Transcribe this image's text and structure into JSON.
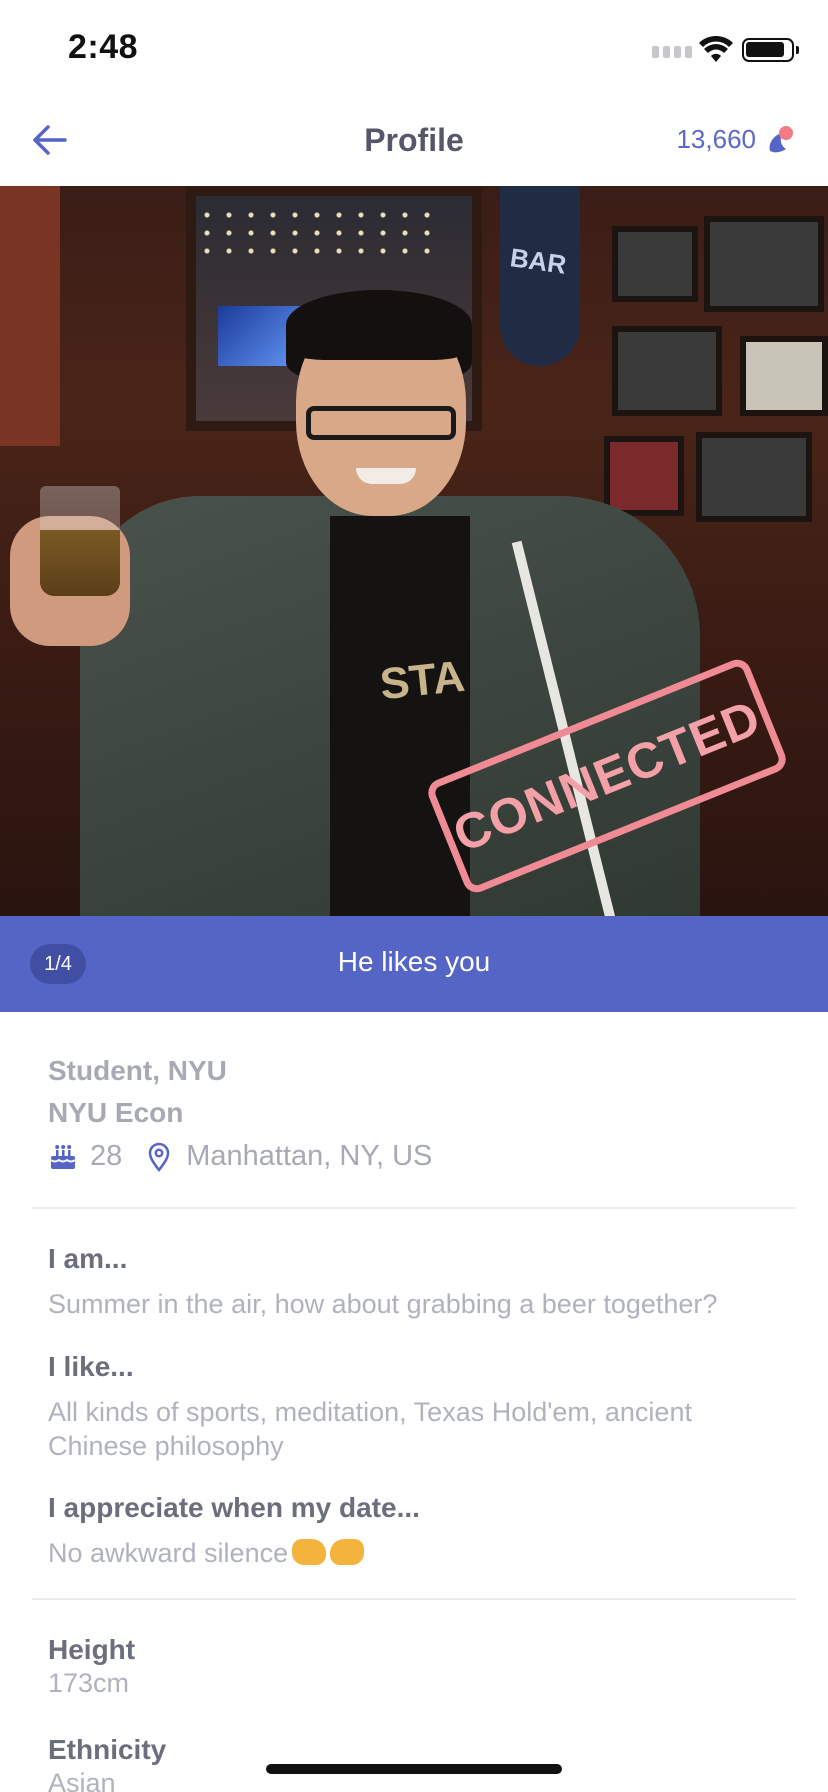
{
  "status_bar": {
    "time": "2:48"
  },
  "nav": {
    "title": "Profile",
    "coins": "13,660"
  },
  "photo": {
    "stamp": "CONNECTED",
    "sign_text": "BAR",
    "shirt_text": "STA"
  },
  "banner": {
    "pager": "1/4",
    "text": "He likes you"
  },
  "profile": {
    "job": "Student, NYU",
    "school": "NYU Econ",
    "age": "28",
    "location": "Manhattan, NY, US"
  },
  "prompts": [
    {
      "question": "I am...",
      "answer": "Summer in the air, how about grabbing a beer together?"
    },
    {
      "question": "I like...",
      "answer": "All kinds of sports, meditation, Texas Hold'em, ancient Chinese philosophy"
    },
    {
      "question": "I appreciate when my date...",
      "answer": "No awkward silence"
    }
  ],
  "details": {
    "height_label": "Height",
    "height_value": "173cm",
    "ethnicity_label": "Ethnicity",
    "ethnicity_value": "Asian"
  },
  "colors": {
    "accent": "#5565c6",
    "stamp": "#f08a94"
  }
}
